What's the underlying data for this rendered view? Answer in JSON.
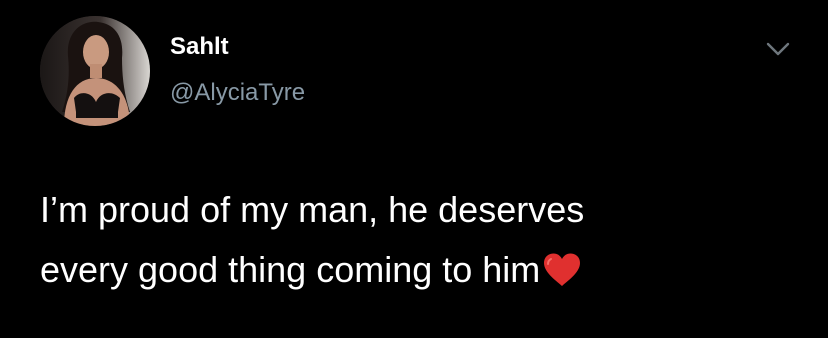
{
  "tweet": {
    "display_name": "Sahlt",
    "handle": "@AlyciaTyre",
    "text_line_1": "I’m proud of my man, he deserves",
    "text_line_2": "every good thing coming to him",
    "emoji_icon": "red-heart-icon",
    "menu_icon": "chevron-down-icon"
  },
  "colors": {
    "background": "#000000",
    "text": "#ffffff",
    "secondary_text": "#8899a6",
    "heart": "#e0302f"
  }
}
